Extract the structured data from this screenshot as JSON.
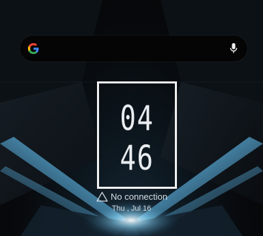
{
  "search": {
    "logo_icon": "google-g-icon",
    "mic_icon": "microphone-icon"
  },
  "clock": {
    "hours": "04",
    "minutes": "46"
  },
  "status": {
    "connection": "No connection",
    "icon": "warning-triangle-icon"
  },
  "date": "Thu , Jul 16",
  "colors": {
    "text": "#e9edf0",
    "glow": "#7fd4ff",
    "search_bar": "#050505"
  }
}
